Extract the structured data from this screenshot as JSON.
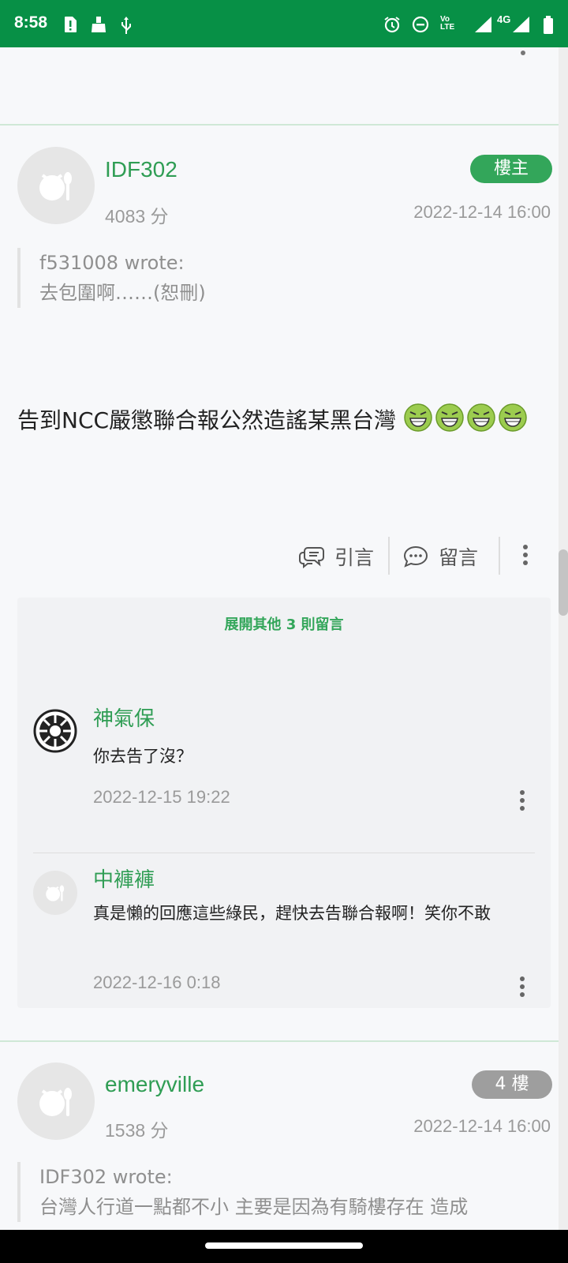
{
  "status_bar": {
    "time": "8:58",
    "network": "4G",
    "volte": "Vo LTE",
    "bg_color": "#079046"
  },
  "post": {
    "username": "IDF302",
    "score": "4083 分",
    "badge": "樓主",
    "timestamp": "2022-12-14 16:00",
    "quote_author": "f531008 wrote:",
    "quote_text": "去包圍啊……(恕刪)",
    "body": "告到NCC嚴懲聯合報公然造謠某黑台灣",
    "actions": {
      "quote": "引言",
      "comment": "留言"
    }
  },
  "comments": {
    "expand_label": "展開其他 3 則留言",
    "items": [
      {
        "name": "神氣保",
        "text": "你去告了沒？",
        "time": "2022-12-15 19:22"
      },
      {
        "name": "中褲褲",
        "text": "真是懶的回應這些綠民，趕快去告聯合報啊！笑你不敢",
        "time": "2022-12-16 0:18"
      }
    ]
  },
  "next_post": {
    "username": "emeryville",
    "score": "1538 分",
    "badge": "4 樓",
    "timestamp": "2022-12-14 16:00",
    "quote_author": "IDF302 wrote:",
    "quote_text": "台灣人行道一點都不小 主要是因為有騎樓存在 造成"
  },
  "colors": {
    "accent_green": "#33a65a",
    "username_green": "#2f9d54",
    "badge_gray": "#9e9e9e"
  },
  "icons": [
    "alarm-icon",
    "dnd-icon",
    "signal-icon",
    "battery-icon",
    "sim-alert-icon",
    "cleaner-icon",
    "usb-icon",
    "quote-bubble-icon",
    "comment-bubble-icon",
    "more-vert-icon",
    "grin-emoji-icon"
  ]
}
